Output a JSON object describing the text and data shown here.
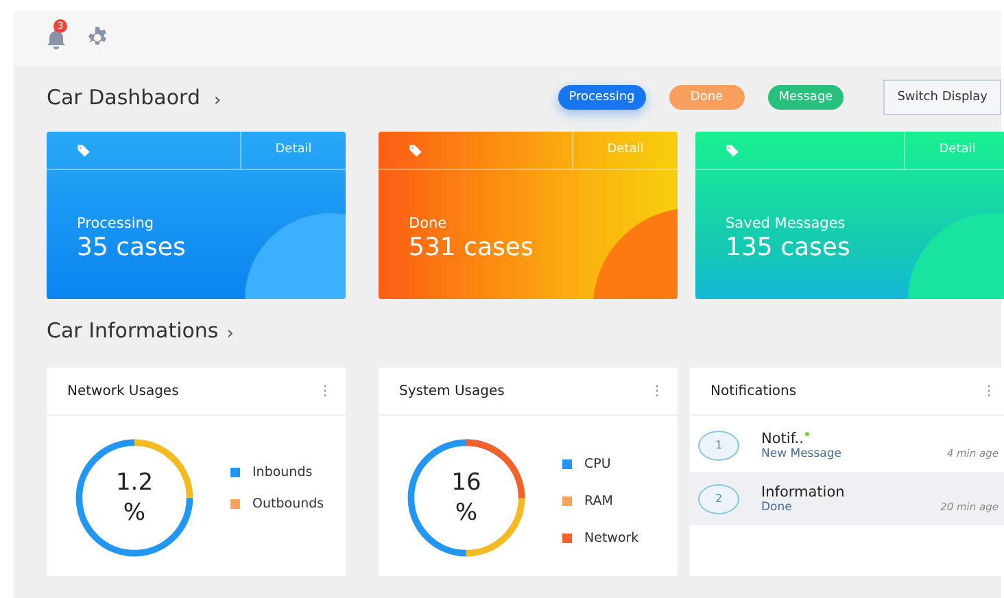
{
  "topbar": {
    "notification_count": "3"
  },
  "dashboard": {
    "title": "Car Dashbaord",
    "chevron": "›",
    "filters": [
      {
        "label": "Processing",
        "kind": "processing"
      },
      {
        "label": "Done",
        "kind": "done"
      },
      {
        "label": "Message",
        "kind": "message"
      }
    ],
    "switch_button": "Switch Display",
    "cards": [
      {
        "kind": "processing",
        "detail": "Detail",
        "label": "Processing",
        "value": "35 cases"
      },
      {
        "kind": "done",
        "detail": "Detail",
        "label": "Done",
        "value": "531 cases"
      },
      {
        "kind": "message",
        "detail": "Detail",
        "label": "Saved Messages",
        "value": "135 cases"
      }
    ]
  },
  "informations": {
    "title": "Car Informations",
    "chevron": "›",
    "panels": [
      {
        "kind": "donut",
        "title": "Network Usages",
        "menu": "⋮",
        "center": [
          "1.2",
          "%"
        ],
        "legend": [
          {
            "label": "Inbounds",
            "color": "#2196f3"
          },
          {
            "label": "Outbounds",
            "color": "#f7a35c"
          }
        ]
      },
      {
        "kind": "donut",
        "title": "System Usages",
        "menu": "⋮",
        "center": [
          "16",
          "%"
        ],
        "legend": [
          {
            "label": "CPU",
            "color": "#2196f3"
          },
          {
            "label": "RAM",
            "color": "#f7a35c"
          },
          {
            "label": "Network",
            "color": "#f4622a"
          }
        ]
      },
      {
        "kind": "list",
        "title": "Notifications",
        "menu": "⋮",
        "items": [
          {
            "number": "1",
            "title": "Notif..",
            "unread": true,
            "subtitle": "New Message",
            "time": "4 min age",
            "selected": false
          },
          {
            "number": "2",
            "title": "Information",
            "unread": false,
            "subtitle": "Done",
            "time": "20 min age",
            "selected": true
          }
        ]
      }
    ]
  }
}
